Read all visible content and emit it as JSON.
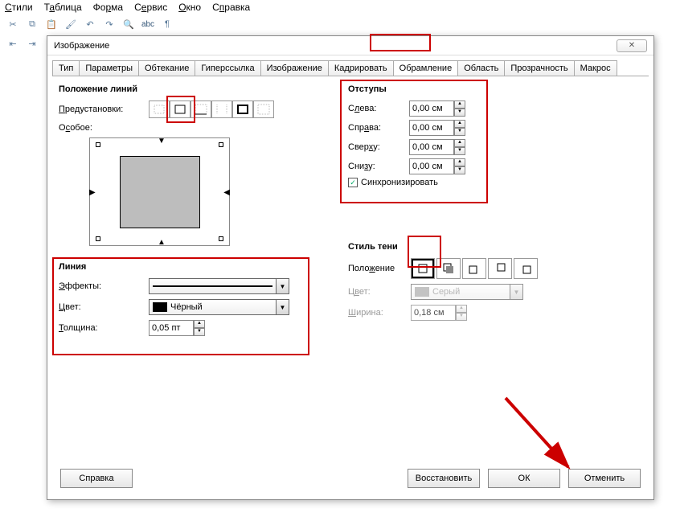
{
  "menu": {
    "styles": "Стили",
    "table": "Таблица",
    "form": "Форма",
    "service": "Сервис",
    "window": "Окно",
    "help": "Справка"
  },
  "dialog": {
    "title": "Изображение"
  },
  "tabs": [
    "Тип",
    "Параметры",
    "Обтекание",
    "Гиперссылка",
    "Изображение",
    "Кадрировать",
    "Обрамление",
    "Область",
    "Прозрачность",
    "Макрос"
  ],
  "active_tab_index": 6,
  "section_lines_title": "Положение линий",
  "presets_label": "Предустановки:",
  "special_label": "Особое:",
  "spacing_title": "Отступы",
  "spacing": {
    "left_label": "Слева:",
    "left_val": "0,00 см",
    "right_label": "Справа:",
    "right_val": "0,00 см",
    "top_label": "Сверху:",
    "top_val": "0,00 см",
    "bottom_label": "Снизу:",
    "bottom_val": "0,00 см",
    "sync_label": "Синхронизировать"
  },
  "line_title": "Линия",
  "line": {
    "effects_label": "Эффекты:",
    "color_label": "Цвет:",
    "color_val": "Чёрный",
    "width_label": "Толщина:",
    "width_val": "0,05 пт"
  },
  "shadow_title": "Стиль тени",
  "shadow": {
    "pos_label": "Положение",
    "color_label": "Цвет:",
    "color_val": "Серый",
    "width_label": "Ширина:",
    "width_val": "0,18 см"
  },
  "buttons": {
    "help": "Справка",
    "restore": "Восстановить",
    "ok": "ОК",
    "cancel": "Отменить"
  }
}
